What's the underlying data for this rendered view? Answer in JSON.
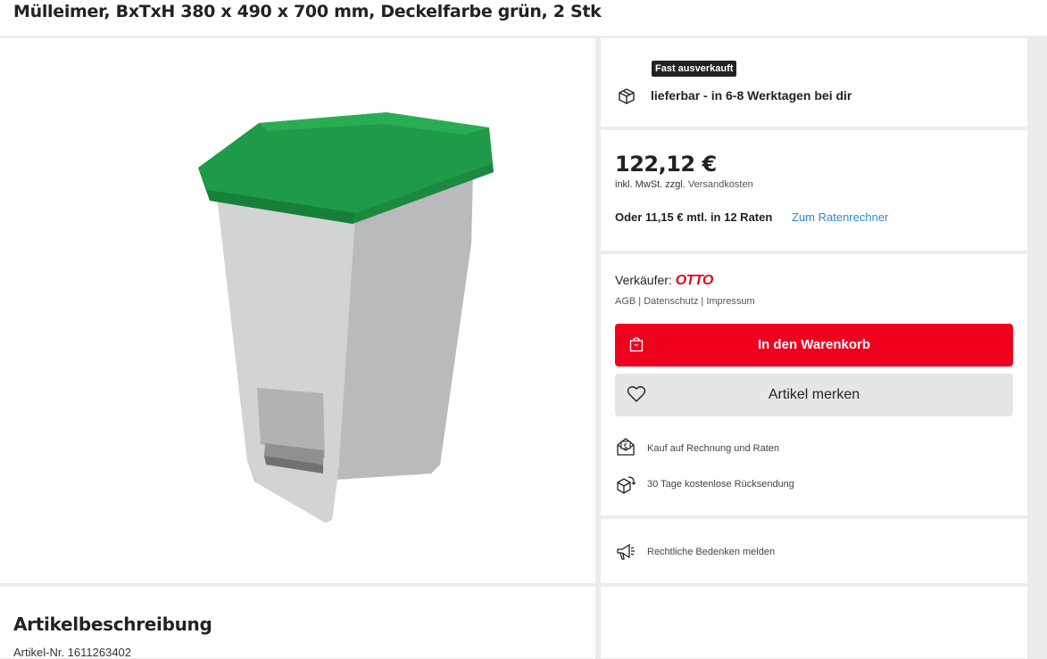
{
  "product": {
    "title": "Mülleimer, BxTxH 380 x 490 x 700 mm, Deckelfarbe grün, 2 Stk",
    "lid_color": "#1f9a48",
    "body_color": "#c6c8ca"
  },
  "stock": {
    "badge": "Fast ausverkauft",
    "delivery": "lieferbar - in 6-8 Werktagen bei dir",
    "icon": "package-icon"
  },
  "pricing": {
    "price": "122,12 €",
    "tax_note": "inkl. MwSt. zzgl.",
    "shipping_link": "Versandkosten",
    "installment": "Oder 11,15 € mtl. in 12 Raten",
    "installment_link": "Zum Ratenrechner"
  },
  "seller": {
    "label": "Verkäufer:",
    "name": "OTTO",
    "legal": "AGB | Datenschutz | Impressum"
  },
  "actions": {
    "cart_label": "In den Warenkorb",
    "wishlist_label": "Artikel merken",
    "accent": "#f0001d"
  },
  "features": [
    {
      "icon": "invoice-icon",
      "label": "Kauf auf Rechnung und Raten"
    },
    {
      "icon": "return-box-icon",
      "label": "30 Tage kostenlose Rücksendung"
    }
  ],
  "report": {
    "icon": "megaphone-icon",
    "label": "Rechtliche Bedenken melden"
  },
  "description": {
    "heading": "Artikelbeschreibung",
    "article_no": "Artikel-Nr. 1611263402"
  }
}
